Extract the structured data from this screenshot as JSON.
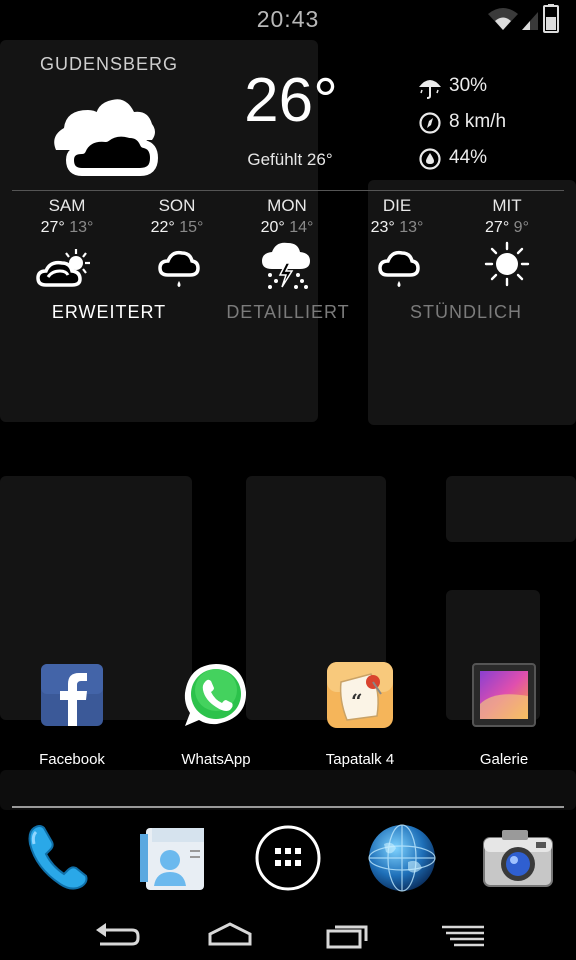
{
  "status_bar": {
    "time": "20:43",
    "icons": [
      "wifi-icon",
      "signal-icon",
      "battery-icon"
    ]
  },
  "weather": {
    "city": "GUDENSBERG",
    "temperature": "26°",
    "feels_like": "Gefühlt 26°",
    "current_icon": "cloudy-night-icon",
    "precipitation": "30%",
    "wind": "8 km/h",
    "humidity": "44%",
    "forecast": [
      {
        "day": "SAM",
        "high": "27°",
        "low": "13°",
        "icon": "partly-sunny-icon"
      },
      {
        "day": "SON",
        "high": "22°",
        "low": "15°",
        "icon": "light-rain-icon"
      },
      {
        "day": "MON",
        "high": "20°",
        "low": "14°",
        "icon": "thunderstorm-icon"
      },
      {
        "day": "DIE",
        "high": "23°",
        "low": "13°",
        "icon": "light-rain-icon"
      },
      {
        "day": "MIT",
        "high": "27°",
        "low": "9°",
        "icon": "sunny-icon"
      }
    ],
    "tabs": [
      "ERWEITERT",
      "DETAILLIERT",
      "STÜNDLICH"
    ],
    "active_tab": "ERWEITERT"
  },
  "apps": [
    {
      "label": "Facebook",
      "icon": "facebook-icon"
    },
    {
      "label": "WhatsApp",
      "icon": "whatsapp-icon"
    },
    {
      "label": "Tapatalk 4",
      "icon": "tapatalk-icon"
    },
    {
      "label": "Galerie",
      "icon": "gallery-icon"
    }
  ],
  "dock": [
    "phone-icon",
    "contacts-icon",
    "app-drawer-icon",
    "browser-globe-icon",
    "camera-icon"
  ],
  "navigation": [
    "back-icon",
    "home-icon",
    "recent-apps-icon",
    "menu-icon"
  ],
  "colors": {
    "background": "#000000",
    "facebook_blue": "#3b5998",
    "whatsapp_green": "#25d366",
    "tapatalk_orange": "#f5b55a",
    "phone_blue": "#2aa8e8"
  }
}
